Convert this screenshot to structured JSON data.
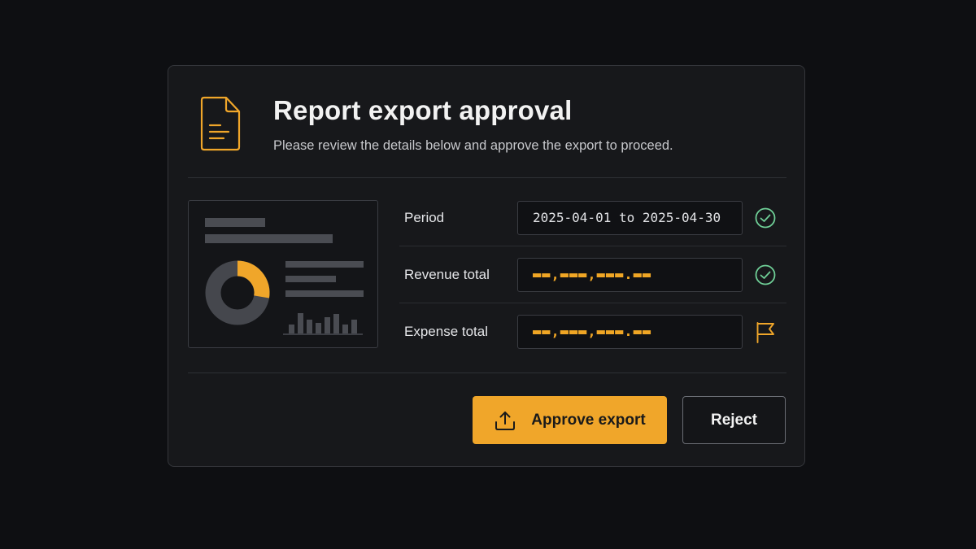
{
  "dialog": {
    "title": "Report export approval",
    "subtitle": "Please review the details below and approve the export to proceed.",
    "header_icon": "document-icon",
    "preview_icon": "report-preview-thumbnail"
  },
  "fields": [
    {
      "label": "Period",
      "value": "2025-04-01 to 2025-04-30",
      "masked": false,
      "status": "verified",
      "status_icon": "check-circle-icon"
    },
    {
      "label": "Revenue total",
      "value": "▬▬,▬▬▬,▬▬▬.▬▬",
      "masked": true,
      "status": "verified",
      "status_icon": "check-circle-icon"
    },
    {
      "label": "Expense total",
      "value": "▬▬,▬▬▬,▬▬▬.▬▬",
      "masked": true,
      "status": "flagged",
      "status_icon": "flag-icon"
    }
  ],
  "actions": {
    "approve_label": "Approve export",
    "approve_icon": "upload-icon",
    "reject_label": "Reject"
  },
  "colors": {
    "accent": "#f0a62a",
    "verified": "#6fcf97",
    "background": "#0e0f12",
    "panel": "#17181b"
  }
}
